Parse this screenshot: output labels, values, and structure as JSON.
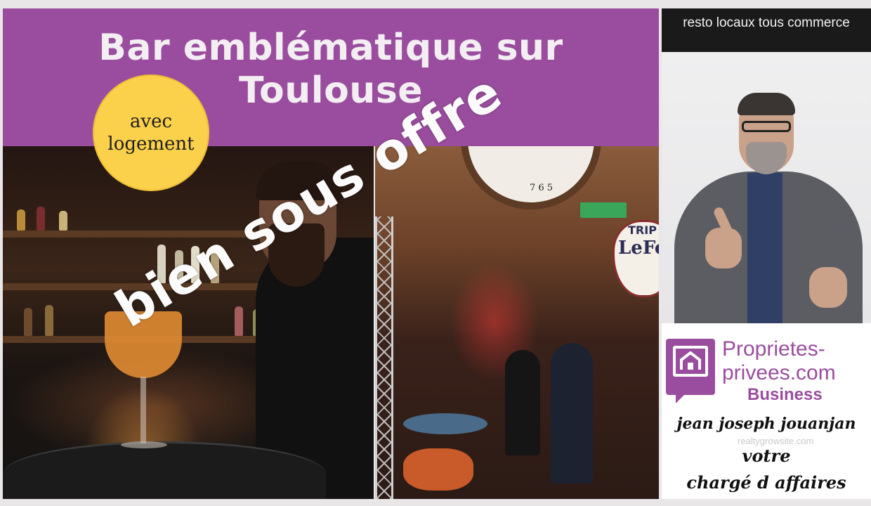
{
  "title": {
    "line1": "Bar emblématique sur",
    "line2": "Toulouse"
  },
  "badge": {
    "line1": "avec",
    "line2": "logement"
  },
  "overlay": {
    "text": "bien sous offre"
  },
  "right_header": "resto locaux tous commerce",
  "logo": {
    "line1": "Proprietes-",
    "line2": "privees.com",
    "line3": "Business"
  },
  "watermark": "realtygrowsite.com",
  "agent": {
    "name": "jean joseph jouanjan",
    "role_line1": "votre",
    "role_line2": "chargé d affaires"
  },
  "photos": {
    "interior_sign": "LeFo",
    "interior_sign_top": "TRIP"
  },
  "colors": {
    "brand_purple": "#9a4d9e",
    "badge_yellow": "#fbd04a",
    "header_black": "#1a1a1a"
  }
}
